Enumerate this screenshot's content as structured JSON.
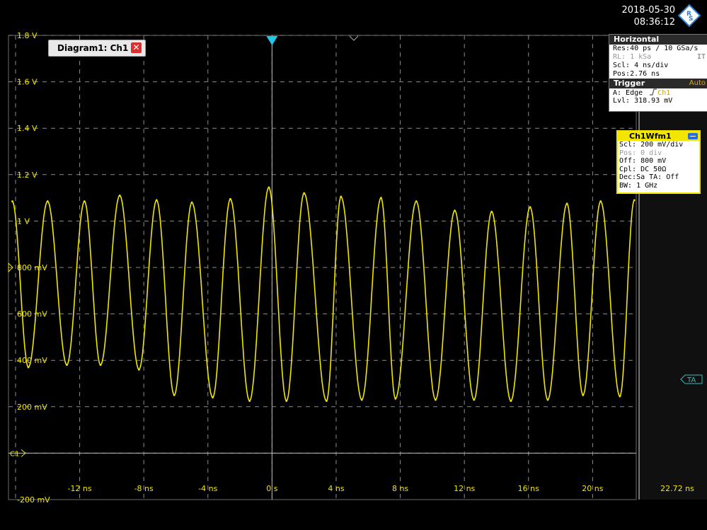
{
  "header": {
    "date": "2018-05-30",
    "time": "08:36:12"
  },
  "diagram_tab": {
    "label": "Diagram1: Ch1",
    "close_glyph": "✕"
  },
  "horizontal": {
    "title": "Horizontal",
    "res": "Res:40 ps / 10 GSa/s",
    "rl": "RL: 1 kSa",
    "scl": "Scl: 4 ns/div",
    "pos": "Pos:2.76 ns",
    "mode_badge": "IT"
  },
  "trigger": {
    "title": "Trigger",
    "mode": "Auto",
    "source_prefix": "A:  Edge",
    "source_channel": "Ch1",
    "level": "Lvl: 318.93 mV"
  },
  "channel_box": {
    "title": "Ch1Wfm1",
    "rows": [
      "Scl: 200 mV/div",
      "Pos: 0 div",
      "Off: 800 mV",
      "Cpl: DC 50Ω",
      "Dec:Sa    TA: Off",
      "BW: 1 GHz"
    ]
  },
  "y_ticks": [
    "1.8 V",
    "1.6 V",
    "1.4 V",
    "1.2 V",
    "1 V",
    "800 mV",
    "600 mV",
    "400 mV",
    "200 mV",
    "-200 mV"
  ],
  "x_ticks": [
    "-12 ns",
    "-8 ns",
    "-4 ns",
    "0 s",
    "4 ns",
    "8 ns",
    "12 ns",
    "16 ns",
    "20 ns"
  ],
  "x_right_label": "22.72 ns",
  "markers": {
    "channel": "C1",
    "ta": "TA"
  },
  "colors": {
    "trace": "#f2e600",
    "grid": "#8a8a8a",
    "trigger": "#1ec8e6",
    "accent": "#e8a800"
  },
  "chart_data": {
    "type": "line",
    "xlabel": "",
    "ylabel": "",
    "xlim": [
      -16.44,
      22.72
    ],
    "ylim": [
      -200,
      1800
    ],
    "x_units": "ns",
    "y_units": "mV",
    "grid": true,
    "series": [
      {
        "values_x": [
          -16.2,
          -15.2,
          -14.0,
          -12.8,
          -11.7,
          -10.7,
          -9.5,
          -8.3,
          -7.2,
          -6.1,
          -5.0,
          -3.7,
          -2.6,
          -1.4,
          -0.2,
          0.9,
          2.0,
          3.4,
          4.3,
          5.6,
          6.8,
          7.7,
          9.0,
          10.2,
          11.4,
          12.6,
          13.7,
          14.9,
          16.1,
          17.2,
          18.4,
          19.4,
          20.5,
          21.7,
          22.6
        ],
        "values_y": [
          1085,
          370,
          1085,
          380,
          1085,
          380,
          1110,
          360,
          1090,
          250,
          1080,
          240,
          1095,
          225,
          1145,
          225,
          1120,
          225,
          1105,
          230,
          1100,
          235,
          1085,
          230,
          1045,
          230,
          1040,
          225,
          1060,
          230,
          1075,
          250,
          1085,
          245,
          1090
        ]
      }
    ]
  }
}
